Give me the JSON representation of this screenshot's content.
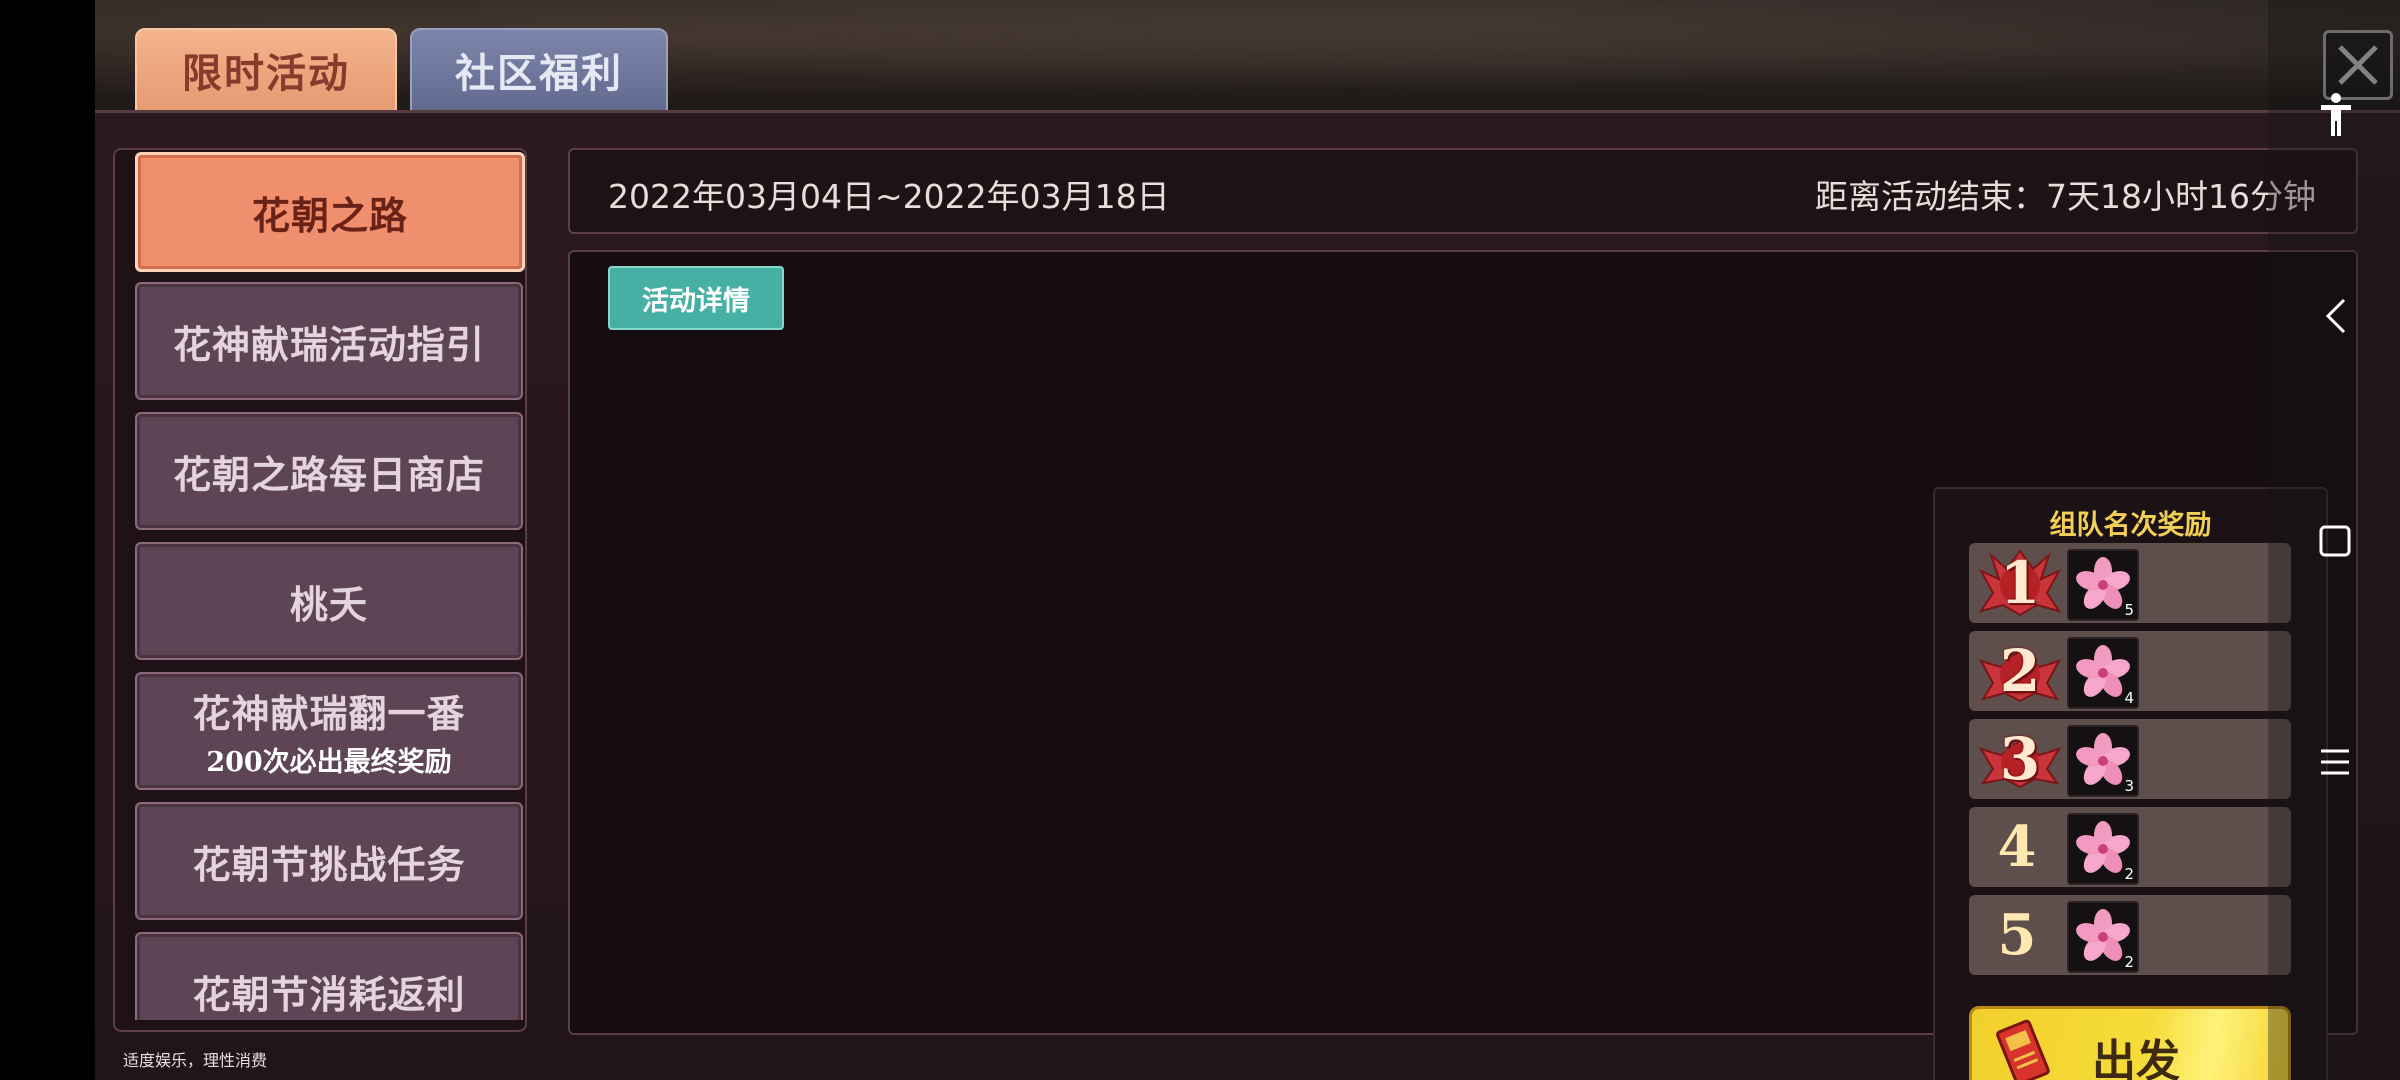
{
  "tabs": [
    {
      "label": "限时活动",
      "active": true
    },
    {
      "label": "社区福利",
      "active": false
    }
  ],
  "sidebar": {
    "items": [
      {
        "label": "花朝之路",
        "sub": ""
      },
      {
        "label": "花神献瑞活动指引",
        "sub": ""
      },
      {
        "label": "花朝之路每日商店",
        "sub": ""
      },
      {
        "label": "桃夭",
        "sub": ""
      },
      {
        "label": "花神献瑞翻一番",
        "sub": "200次必出最终奖励"
      },
      {
        "label": "花朝节挑战任务",
        "sub": ""
      },
      {
        "label": "花朝节消耗返利",
        "sub": ""
      }
    ]
  },
  "footer_note": "适度娱乐，理性消费",
  "header": {
    "date_range": "2022年03月04日~2022年03月18日",
    "countdown": "距离活动结束：7天18小时16分钟"
  },
  "detail_button": "活动详情",
  "ranking": {
    "title": "组队名次奖励",
    "rows": [
      {
        "rank": "1",
        "count": "5"
      },
      {
        "rank": "2",
        "count": "4"
      },
      {
        "rank": "3",
        "count": "3"
      },
      {
        "rank": "4",
        "count": "2"
      },
      {
        "rank": "5",
        "count": "2"
      }
    ],
    "item_icon": "pink-blossom-icon"
  },
  "go_button": "出发",
  "colors": {
    "active_tab": "#f4b48c",
    "inactive_tab": "#7d85aa",
    "active_item": "#ef8f6e",
    "item": "#5e4556",
    "detail_button": "#45b0a3",
    "go_button": "#f1cf2c",
    "rank_title": "#f2cf55"
  },
  "system_icons": [
    "accessibility-icon",
    "back-icon",
    "home-icon",
    "menu-icon"
  ]
}
